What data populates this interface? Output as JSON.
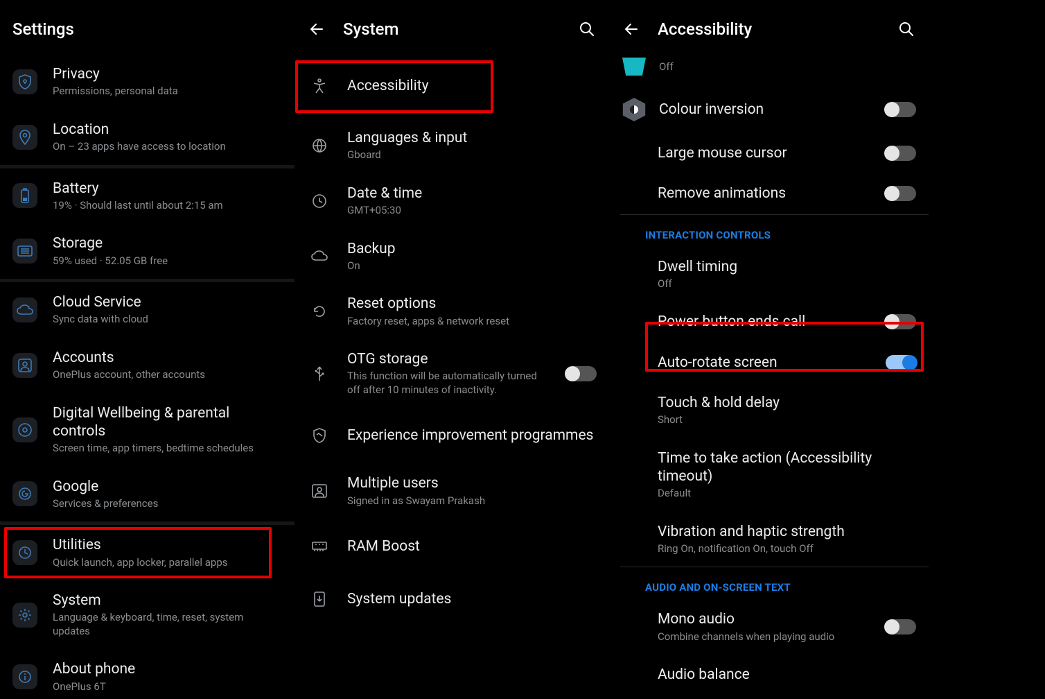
{
  "panel1": {
    "title": "Settings",
    "items": [
      {
        "label": "Privacy",
        "sub": "Permissions, personal data"
      },
      {
        "label": "Location",
        "sub": "On – 23 apps have access to location"
      },
      {
        "label": "Battery",
        "sub": "19% · Should last until about 2:15 am"
      },
      {
        "label": "Storage",
        "sub": "59% used · 52.05 GB free"
      },
      {
        "label": "Cloud Service",
        "sub": "Sync data with cloud"
      },
      {
        "label": "Accounts",
        "sub": "OnePlus account, other accounts"
      },
      {
        "label": "Digital Wellbeing & parental controls",
        "sub": "Screen time, app timers, bedtime schedules"
      },
      {
        "label": "Google",
        "sub": "Services & preferences"
      },
      {
        "label": "Utilities",
        "sub": "Quick launch, app locker, parallel apps"
      },
      {
        "label": "System",
        "sub": "Language & keyboard, time, reset, system updates"
      },
      {
        "label": "About phone",
        "sub": "OnePlus 6T"
      }
    ]
  },
  "panel2": {
    "title": "System",
    "items": [
      {
        "label": "Accessibility",
        "sub": ""
      },
      {
        "label": "Languages & input",
        "sub": "Gboard"
      },
      {
        "label": "Date & time",
        "sub": "GMT+05:30"
      },
      {
        "label": "Backup",
        "sub": "On"
      },
      {
        "label": "Reset options",
        "sub": "Factory reset, apps & network reset"
      },
      {
        "label": "OTG storage",
        "sub": "This function will be automatically turned off after 10 minutes of inactivity."
      },
      {
        "label": "Experience improvement programmes",
        "sub": ""
      },
      {
        "label": "Multiple users",
        "sub": "Signed in as Swayam Prakash"
      },
      {
        "label": "RAM Boost",
        "sub": ""
      },
      {
        "label": "System updates",
        "sub": ""
      }
    ]
  },
  "panel3": {
    "title": "Accessibility",
    "top_sub": "Off",
    "items": [
      {
        "label": "Colour inversion",
        "toggle": "off",
        "icon": true
      },
      {
        "label": "Large mouse cursor",
        "toggle": "off"
      },
      {
        "label": "Remove animations",
        "toggle": "off"
      }
    ],
    "section1": "INTERACTION CONTROLS",
    "items2": [
      {
        "label": "Dwell timing",
        "sub": "Off"
      },
      {
        "label": "Power button ends call",
        "toggle": "off"
      },
      {
        "label": "Auto-rotate screen",
        "toggle": "on"
      },
      {
        "label": "Touch & hold delay",
        "sub": "Short"
      },
      {
        "label": "Time to take action (Accessibility timeout)",
        "sub": "Default"
      },
      {
        "label": "Vibration and haptic strength",
        "sub": "Ring On, notification On, touch Off"
      }
    ],
    "section2": "AUDIO AND ON-SCREEN TEXT",
    "items3": [
      {
        "label": "Mono audio",
        "sub": "Combine channels when playing audio",
        "toggle": "off"
      },
      {
        "label": "Audio balance",
        "sub": ""
      }
    ]
  }
}
